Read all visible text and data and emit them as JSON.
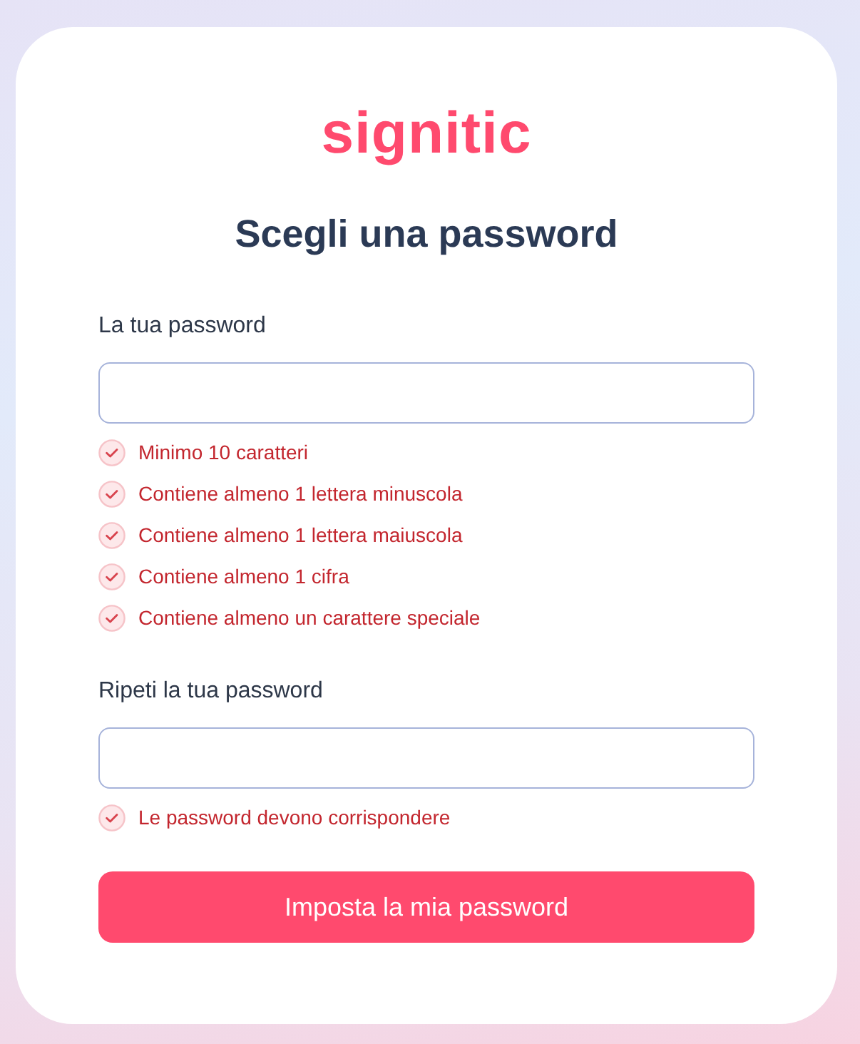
{
  "logo": {
    "text": "signitic"
  },
  "title": "Scegli una password",
  "fields": [
    {
      "label": "La tua password",
      "rules": [
        {
          "text": "Minimo 10 caratteri",
          "met": false
        },
        {
          "text": "Contiene almeno 1 lettera minuscola",
          "met": false
        },
        {
          "text": "Contiene almeno 1 lettera maiuscola",
          "met": false
        },
        {
          "text": "Contiene almeno 1 cifra",
          "met": false
        },
        {
          "text": "Contiene almeno un carattere speciale",
          "met": false
        }
      ]
    },
    {
      "label": "Ripeti la tua password",
      "rules": [
        {
          "text": "Le password devono corrispondere",
          "met": false
        }
      ]
    }
  ],
  "submit_button": {
    "label": "Imposta la mia password"
  }
}
